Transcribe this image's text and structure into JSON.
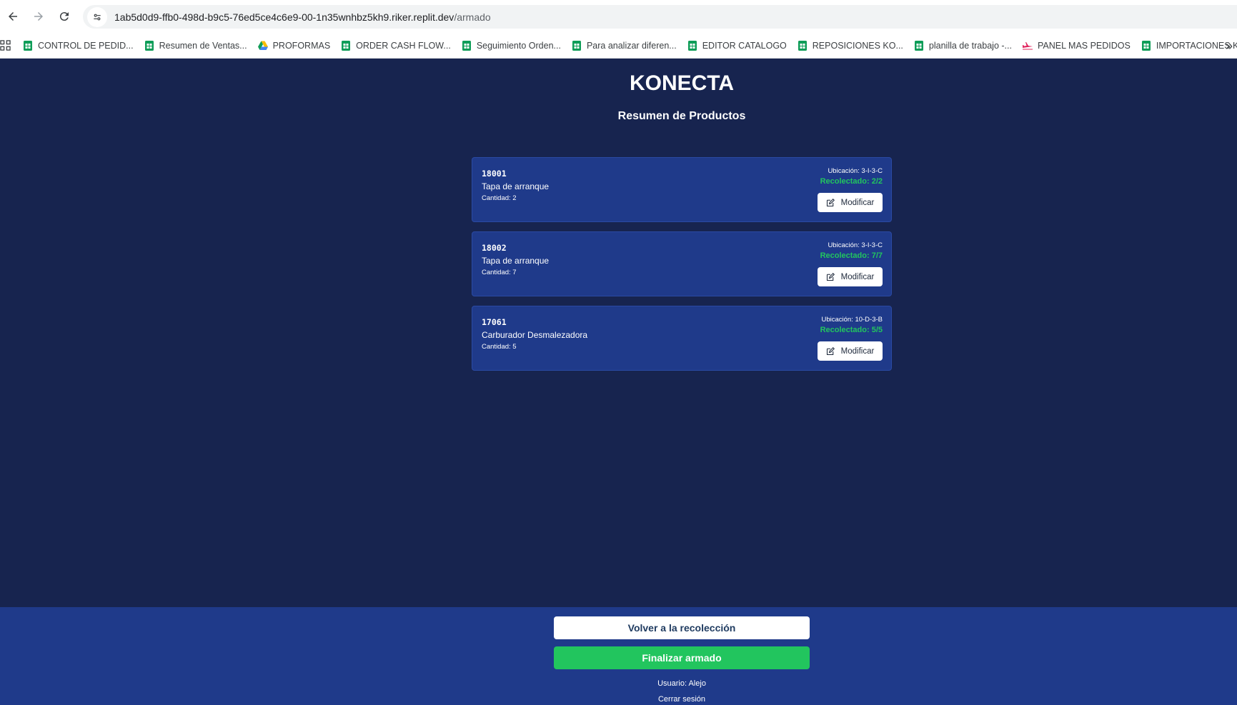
{
  "browser": {
    "url_host": "1ab5d0d9-ffb0-498d-b9c5-76ed5ce4c6e9-00-1n35wnhbz5kh9.riker.replit.dev",
    "url_path": "/armado",
    "bookmarks": [
      {
        "label": "CONTROL DE PEDID...",
        "icon": "sheets-icon"
      },
      {
        "label": "Resumen de Ventas...",
        "icon": "sheets-icon"
      },
      {
        "label": "PROFORMAS",
        "icon": "drive-icon"
      },
      {
        "label": "ORDER CASH FLOW...",
        "icon": "sheets-icon"
      },
      {
        "label": "Seguimiento Orden...",
        "icon": "sheets-icon"
      },
      {
        "label": "Para analizar diferen...",
        "icon": "sheets-icon"
      },
      {
        "label": "EDITOR CATALOGO",
        "icon": "sheets-icon"
      },
      {
        "label": "REPOSICIONES KO...",
        "icon": "sheets-icon"
      },
      {
        "label": "planilla de trabajo -...",
        "icon": "sheets-icon"
      },
      {
        "label": "PANEL MAS PEDIDOS",
        "icon": "plane-icon"
      },
      {
        "label": "IMPORTACIONES K...",
        "icon": "sheets-icon"
      }
    ],
    "more_label": "»"
  },
  "header": {
    "title": "KONECTA",
    "subtitle": "Resumen de Productos"
  },
  "products": [
    {
      "code": "18001",
      "name": "Tapa de arranque",
      "quantity": "Cantidad: 2",
      "location": "Ubicación: 3-I-3-C",
      "picked": "Recolectado: 2/2",
      "button": "Modificar"
    },
    {
      "code": "18002",
      "name": "Tapa de arranque",
      "quantity": "Cantidad: 7",
      "location": "Ubicación: 3-I-3-C",
      "picked": "Recolectado: 7/7",
      "button": "Modificar"
    },
    {
      "code": "17061",
      "name": "Carburador Desmalezadora",
      "quantity": "Cantidad: 5",
      "location": "Ubicación: 10-D-3-B",
      "picked": "Recolectado: 5/5",
      "button": "Modificar"
    }
  ],
  "footer": {
    "back_button": "Volver a la recolección",
    "finish_button": "Finalizar armado",
    "user": "Usuario: Alejo",
    "logout": "Cerrar sesión"
  },
  "colors": {
    "page_bg": "#17244f",
    "card_bg": "#1f3a8a",
    "footer_bg": "#1f3a8a",
    "success": "#22c55e"
  }
}
